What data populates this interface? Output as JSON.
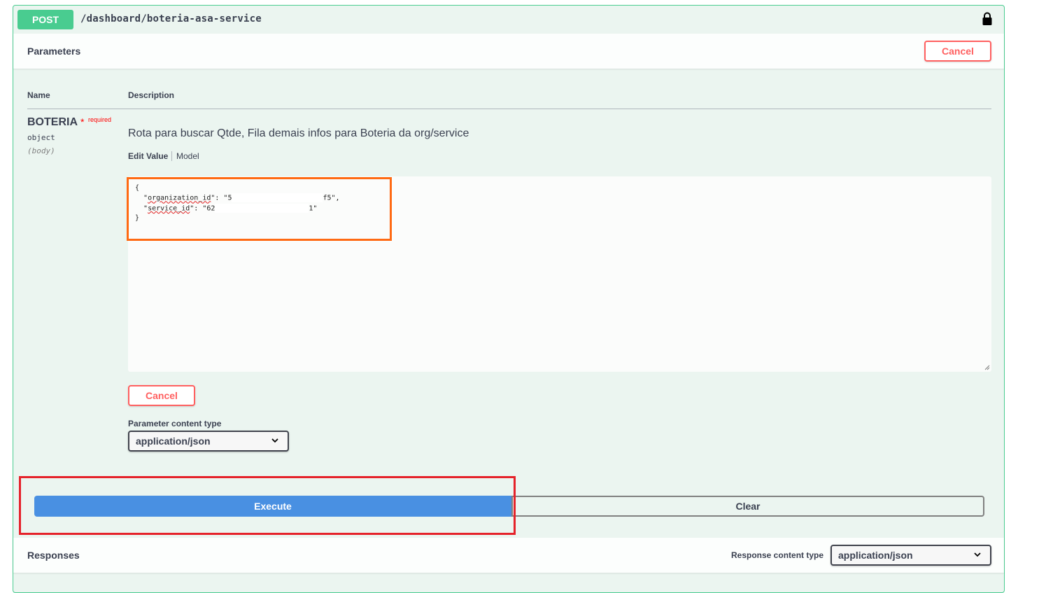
{
  "operation": {
    "method": "POST",
    "path": "/dashboard/boteria-asa-service",
    "lock_icon": "lock-icon"
  },
  "parameters": {
    "title": "Parameters",
    "cancel_label": "Cancel",
    "col_name": "Name",
    "col_description": "Description",
    "param": {
      "name": "BOTERIA",
      "star": "*",
      "required": "required",
      "type": "object",
      "in": "(body)",
      "description": "Rota para buscar Qtde, Fila demais infos para Boteria da org/service"
    },
    "tabs": {
      "edit_value": "Edit Value",
      "model": "Model"
    },
    "body": {
      "l1": "{",
      "l2a_pre": "  \"",
      "l2a_key": "organization_id",
      "l2a_mid": "\": \"5",
      "l2a_tail": "f5\",",
      "l3_pre": "  \"",
      "l3_key": "service_id",
      "l3_mid": "\": \"62",
      "l3_tail": "1\"",
      "l4": "}"
    },
    "cancel_bottom_label": "Cancel",
    "content_type_label": "Parameter content type",
    "content_type_value": "application/json"
  },
  "actions": {
    "execute_label": "Execute",
    "clear_label": "Clear"
  },
  "responses": {
    "title": "Responses",
    "content_type_label": "Response content type",
    "content_type_value": "application/json"
  },
  "colors": {
    "post_green": "#49cc90",
    "execute_blue": "#4990e2",
    "cancel_red": "#ff6060",
    "highlight_orange": "#ff6a13",
    "highlight_red": "#e5222a"
  }
}
